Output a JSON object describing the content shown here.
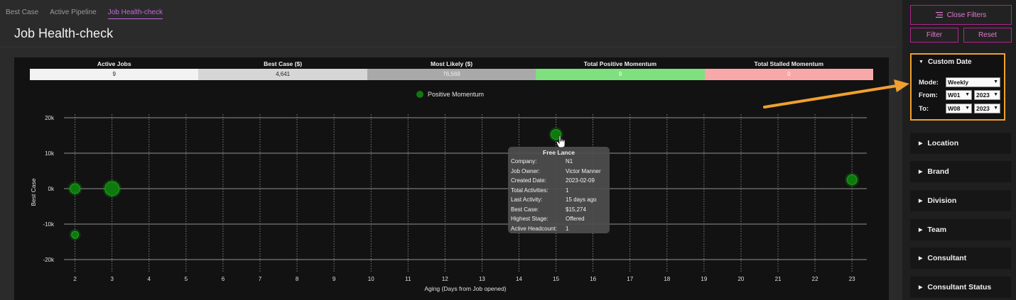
{
  "tabs": [
    "Best Case",
    "Active Pipeline",
    "Job Health-check"
  ],
  "page_title": "Job Health-check",
  "kpis": [
    {
      "label": "Active Jobs",
      "value": "9",
      "bg": "#f2f2f2",
      "fg": "#222222"
    },
    {
      "label": "Best Case ($)",
      "value": "4,641",
      "bg": "#d6d6d6",
      "fg": "#222222"
    },
    {
      "label": "Most Likely ($)",
      "value": "76,569",
      "bg": "#a9a9a9",
      "fg": "#f0f0f0"
    },
    {
      "label": "Total Positive Momentum",
      "value": "9",
      "bg": "#7ee07e",
      "fg": "#ffffff"
    },
    {
      "label": "Total Stalled Momentum",
      "value": "0",
      "bg": "#f8a8a8",
      "fg": "#ffffff"
    }
  ],
  "legend": {
    "label": "Positive Momentum",
    "color": "#0e7a0e"
  },
  "chart_data": {
    "type": "scatter",
    "xlabel": "Aging (Days from Job opened)",
    "ylabel": "Best Case",
    "x_ticks": [
      2,
      3,
      4,
      5,
      6,
      7,
      8,
      9,
      10,
      11,
      12,
      13,
      14,
      15,
      16,
      17,
      18,
      19,
      20,
      21,
      22,
      23
    ],
    "y_ticks": [
      {
        "v": 20000,
        "label": "20k"
      },
      {
        "v": 10000,
        "label": "10k"
      },
      {
        "v": 0,
        "label": "0k"
      },
      {
        "v": -10000,
        "label": "-10k"
      },
      {
        "v": -20000,
        "label": "-20k"
      }
    ],
    "xlim": [
      1.7,
      23.4
    ],
    "ylim": [
      -23000,
      21000
    ],
    "series": [
      {
        "name": "Positive Momentum",
        "color": "#0e7a0e",
        "points": [
          {
            "x": 2,
            "y": 0,
            "r": 7
          },
          {
            "x": 2,
            "y": -13000,
            "r": 5
          },
          {
            "x": 3,
            "y": 0,
            "r": 10
          },
          {
            "x": 15,
            "y": 15274,
            "r": 7
          },
          {
            "x": 23,
            "y": 2500,
            "r": 7
          }
        ]
      }
    ]
  },
  "tooltip": {
    "title": "Free Lance",
    "rows": [
      {
        "k": "Company:",
        "v": "N1"
      },
      {
        "k": "Job Owner:",
        "v": "Victor Manner"
      },
      {
        "k": "Created Date:",
        "v": "2023-02-09"
      },
      {
        "k": "Total Activities:",
        "v": "1"
      },
      {
        "k": "Last Activity:",
        "v": "15 days ago"
      },
      {
        "k": "Best Case:",
        "v": "$15,274"
      },
      {
        "k": "Highest Stage:",
        "v": "Offered"
      },
      {
        "k": "Active Headcount:",
        "v": "1"
      }
    ]
  },
  "sidebar": {
    "close_filters": "Close Filters",
    "filter": "Filter",
    "reset": "Reset",
    "custom_date": {
      "title": "Custom Date",
      "mode_label": "Mode:",
      "mode_value": "Weekly",
      "from_label": "From:",
      "from_week": "W01",
      "from_year": "2023",
      "to_label": "To:",
      "to_week": "W08",
      "to_year": "2023"
    },
    "filters": [
      "Location",
      "Brand",
      "Division",
      "Team",
      "Consultant",
      "Consultant Status"
    ]
  }
}
